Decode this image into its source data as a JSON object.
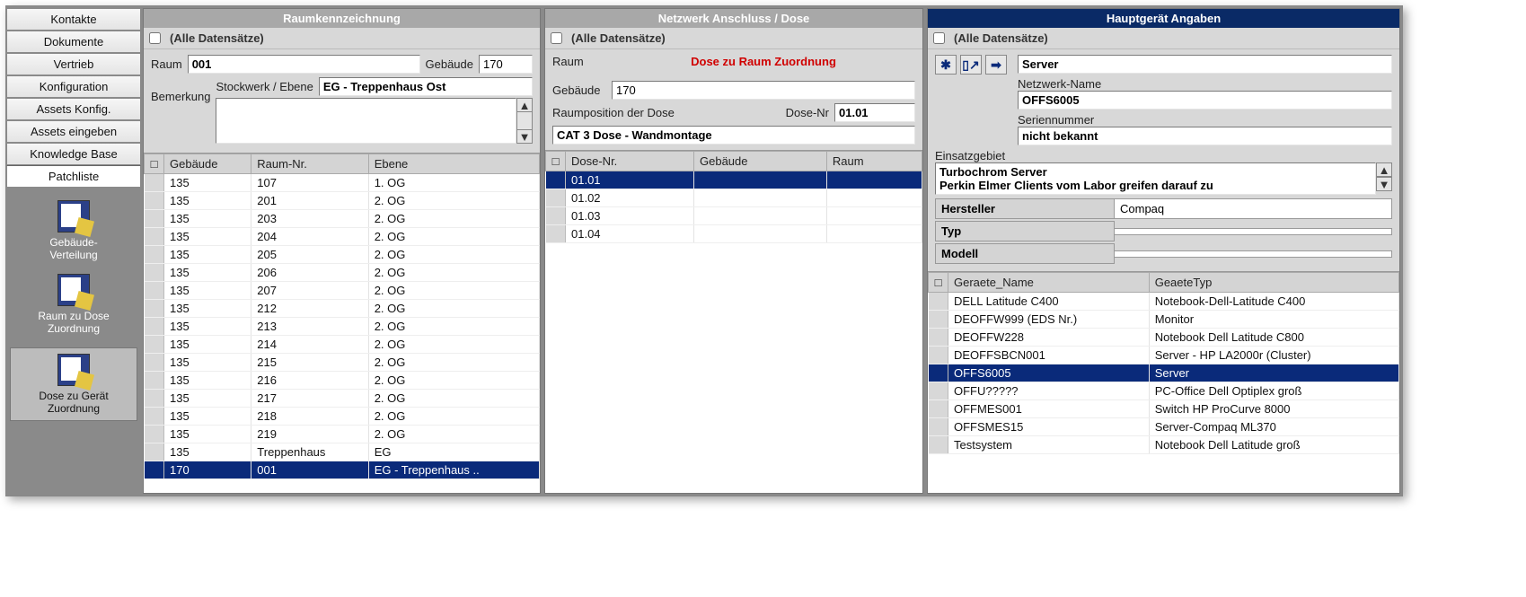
{
  "sidebar": {
    "nav": [
      "Kontakte",
      "Dokumente",
      "Vertrieb",
      "Konfiguration",
      "Assets Konfig.",
      "Assets eingeben",
      "Knowledge Base",
      "Patchliste"
    ],
    "activeIndex": 7,
    "tools": [
      {
        "label": "Gebäude-\nVerteilung"
      },
      {
        "label": "Raum zu Dose\nZuordnung"
      },
      {
        "label": "Dose zu Gerät\nZuordnung"
      }
    ],
    "toolsSelected": 2
  },
  "panel1": {
    "title": "Raumkennzeichnung",
    "allRecordsLabel": "(Alle Datensätze)",
    "labels": {
      "raum": "Raum",
      "gebaeude": "Gebäude",
      "stockwerk": "Stockwerk / Ebene",
      "bemerkung": "Bemerkung"
    },
    "raum": "001",
    "gebaeude": "170",
    "stockwerk": "EG - Treppenhaus Ost",
    "bemerkung": "",
    "columns": [
      "",
      "Gebäude",
      "Raum-Nr.",
      "Ebene"
    ],
    "rows": [
      [
        "135",
        "107",
        "1. OG"
      ],
      [
        "135",
        "201",
        "2. OG"
      ],
      [
        "135",
        "203",
        "2. OG"
      ],
      [
        "135",
        "204",
        "2. OG"
      ],
      [
        "135",
        "205",
        "2. OG"
      ],
      [
        "135",
        "206",
        "2. OG"
      ],
      [
        "135",
        "207",
        "2. OG"
      ],
      [
        "135",
        "212",
        "2. OG"
      ],
      [
        "135",
        "213",
        "2. OG"
      ],
      [
        "135",
        "214",
        "2. OG"
      ],
      [
        "135",
        "215",
        "2. OG"
      ],
      [
        "135",
        "216",
        "2. OG"
      ],
      [
        "135",
        "217",
        "2. OG"
      ],
      [
        "135",
        "218",
        "2. OG"
      ],
      [
        "135",
        "219",
        "2. OG"
      ],
      [
        "135",
        "Treppenhaus",
        "EG"
      ],
      [
        "170",
        "001",
        "EG - Treppenhaus .."
      ]
    ],
    "selectedRow": 16
  },
  "panel2": {
    "title": "Netzwerk Anschluss / Dose",
    "allRecordsLabel": "(Alle Datensätze)",
    "heading": "Dose zu Raum Zuordnung",
    "labels": {
      "raum": "Raum",
      "gebaeude": "Gebäude",
      "raumpos": "Raumposition der Dose",
      "dosenr": "Dose-Nr"
    },
    "raum": "",
    "gebaeude": "170",
    "dosenr": "01.01",
    "raumpos": "CAT 3 Dose - Wandmontage",
    "columns": [
      "",
      "Dose-Nr.",
      "Gebäude",
      "Raum"
    ],
    "rows": [
      [
        "01.01",
        "",
        ""
      ],
      [
        "01.02",
        "",
        ""
      ],
      [
        "01.03",
        "",
        ""
      ],
      [
        "01.04",
        "",
        ""
      ]
    ],
    "selectedRow": 0
  },
  "panel3": {
    "title": "Hauptgerät Angaben",
    "allRecordsLabel": "(Alle Datensätze)",
    "typeValue": "Server",
    "labels": {
      "netname": "Netzwerk-Name",
      "sn": "Seriennummer",
      "einsatz": "Einsatzgebiet"
    },
    "netname": "OFFS6005",
    "sn": "nicht bekannt",
    "einsatz": "Turbochrom Server\nPerkin Elmer Clients vom Labor greifen darauf zu",
    "kv": [
      [
        "Hersteller",
        "Compaq"
      ],
      [
        "Typ",
        ""
      ],
      [
        "Modell",
        ""
      ]
    ],
    "columns": [
      "",
      "Geraete_Name",
      "GeaeteTyp"
    ],
    "rows": [
      [
        "DELL Latitude C400",
        "Notebook-Dell-Latitude C400"
      ],
      [
        "DEOFFW999 (EDS Nr.)",
        "Monitor"
      ],
      [
        "DEOFFW228",
        "Notebook Dell Latitude C800"
      ],
      [
        "DEOFFSBCN001",
        "Server - HP LA2000r (Cluster)"
      ],
      [
        "OFFS6005",
        "Server"
      ],
      [
        "OFFU?????",
        "PC-Office Dell Optiplex groß"
      ],
      [
        "OFFMES001",
        "Switch HP ProCurve 8000"
      ],
      [
        "OFFSMES15",
        "Server-Compaq ML370"
      ],
      [
        "Testsystem",
        "Notebook Dell Latitude groß"
      ]
    ],
    "selectedRow": 4
  }
}
